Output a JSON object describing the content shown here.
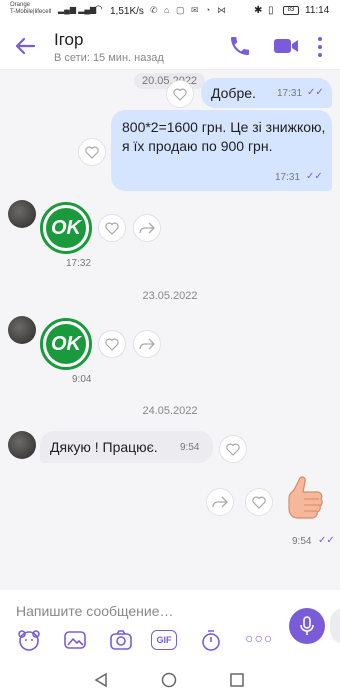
{
  "status_bar": {
    "carrier_line1": "Orange",
    "carrier_line2": "T-Mobile|lifecell",
    "speed": "1,51K/s",
    "battery": "83",
    "time": "11:14"
  },
  "header": {
    "contact_name": "Ігор",
    "status": "В сети: 15 мин. назад"
  },
  "messages": {
    "date_top": "20.05.2022",
    "m1_text": "Добре.",
    "m1_time": "17:31",
    "m2_text": "800*2=1600 грн. Це зі знижкою, я їх продаю по 900 грн.",
    "m2_time": "17:31",
    "sticker1_label": "OK",
    "sticker1_time": "17:32",
    "date2": "23.05.2022",
    "sticker2_label": "OK",
    "sticker2_time": "9:04",
    "date3": "24.05.2022",
    "m3_text": "Дякую ! Працює.",
    "m3_time": "9:54",
    "thumb_time": "9:54"
  },
  "composer": {
    "placeholder": "Напишите сообщение…",
    "gif_label": "GIF"
  },
  "colors": {
    "accent": "#7a5cd8",
    "outgoing_bubble": "#d6e5ff",
    "incoming_bubble": "#ececf0",
    "ok_green": "#1a9a3c"
  }
}
